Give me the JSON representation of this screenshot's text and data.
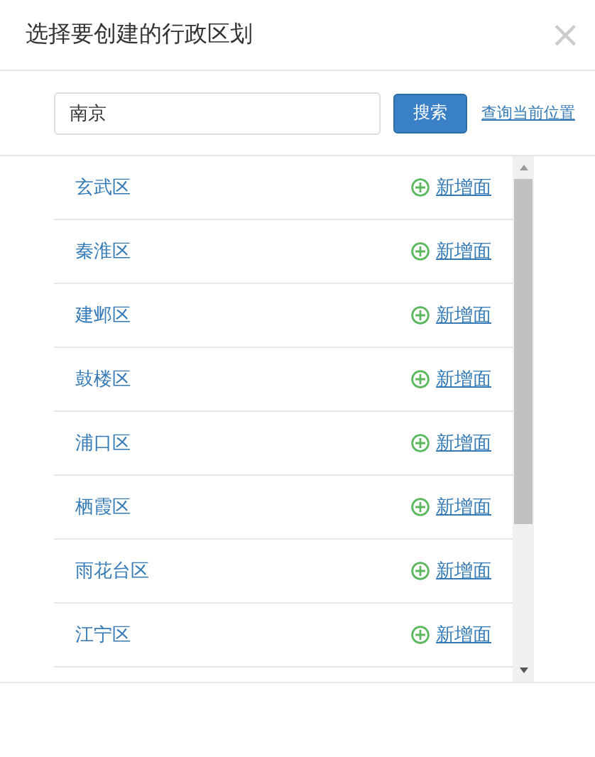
{
  "dialog": {
    "title": "选择要创建的行政区划",
    "close": "×"
  },
  "search": {
    "value": "南京",
    "button": "搜索",
    "locate_link": "查询当前位置"
  },
  "districts": [
    {
      "name": "玄武区",
      "action": "新增面"
    },
    {
      "name": "秦淮区",
      "action": "新增面"
    },
    {
      "name": "建邺区",
      "action": "新增面"
    },
    {
      "name": "鼓楼区",
      "action": "新增面"
    },
    {
      "name": "浦口区",
      "action": "新增面"
    },
    {
      "name": "栖霞区",
      "action": "新增面"
    },
    {
      "name": "雨花台区",
      "action": "新增面"
    },
    {
      "name": "江宁区",
      "action": "新增面"
    }
  ]
}
